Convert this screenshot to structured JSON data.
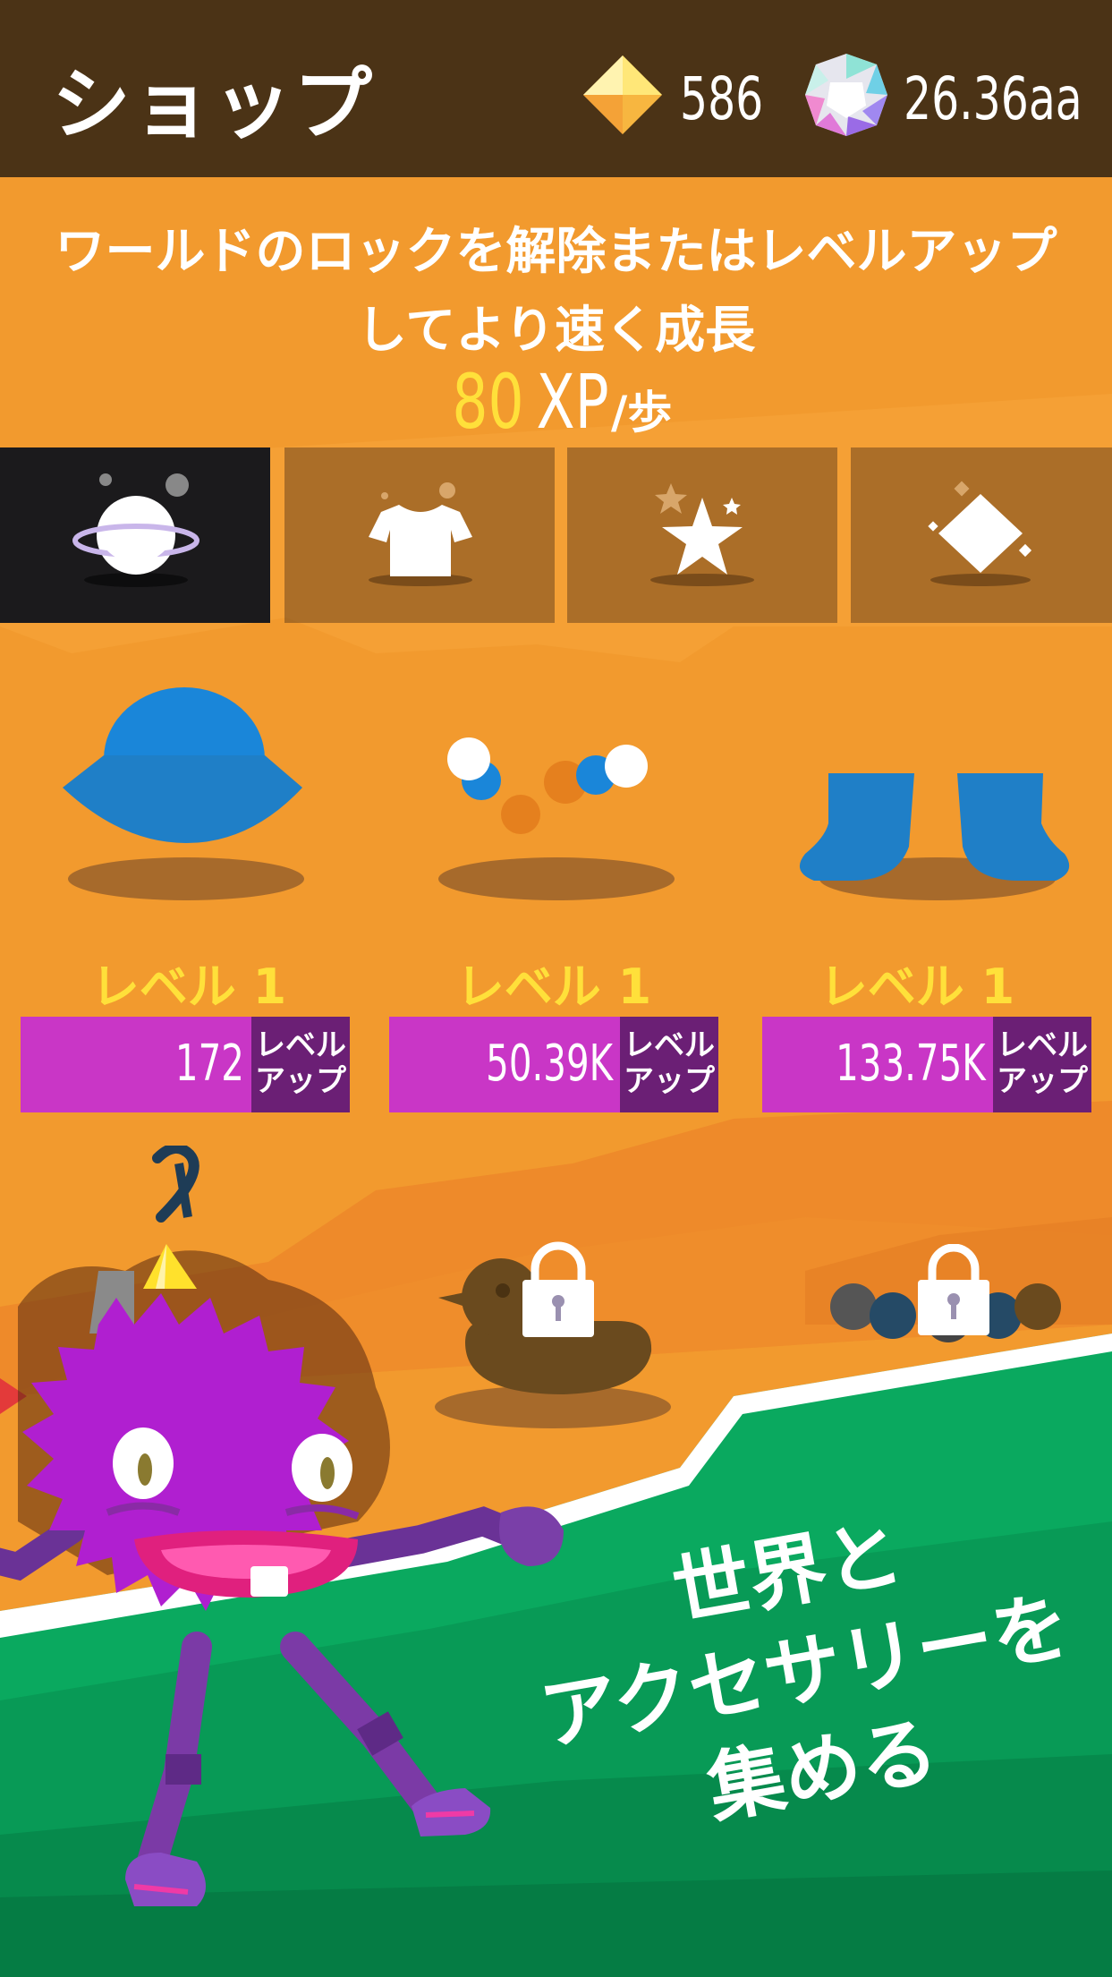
{
  "header": {
    "title": "ショップ",
    "gems": "586",
    "crystals": "26.36aa"
  },
  "headline": {
    "line1": "ワールドのロックを解除またはレベルアップ",
    "line2": "してより速く成長",
    "xp_value": "80",
    "xp_unit": "XP",
    "xp_per": "/歩"
  },
  "tabs": [
    {
      "icon": "planet-icon",
      "active": true
    },
    {
      "icon": "tshirt-icon",
      "active": false
    },
    {
      "icon": "star-icon",
      "active": false
    },
    {
      "icon": "diamond-icon",
      "active": false
    }
  ],
  "items": [
    {
      "icon": "hat-icon",
      "level": "レベル 1",
      "price": "172",
      "button": "レベル\nアップ"
    },
    {
      "icon": "beads-icon",
      "level": "レベル 1",
      "price": "50.39K",
      "button": "レベル\nアップ"
    },
    {
      "icon": "boots-icon",
      "level": "レベル 1",
      "price": "133.75K",
      "button": "レベル\nアップ"
    }
  ],
  "promo": {
    "line1": "世界と",
    "line2": "アクセサリーを",
    "line3": "集める"
  },
  "colors": {
    "header_bg": "#4b3316",
    "orange_bg": "#f29a2e",
    "accent_yellow": "#ffe03a",
    "buy_magenta": "#c936c6",
    "buy_button_purple": "#6b1f75",
    "grass_green": "#0aa95f",
    "monster_purple": "#b01fd0"
  }
}
